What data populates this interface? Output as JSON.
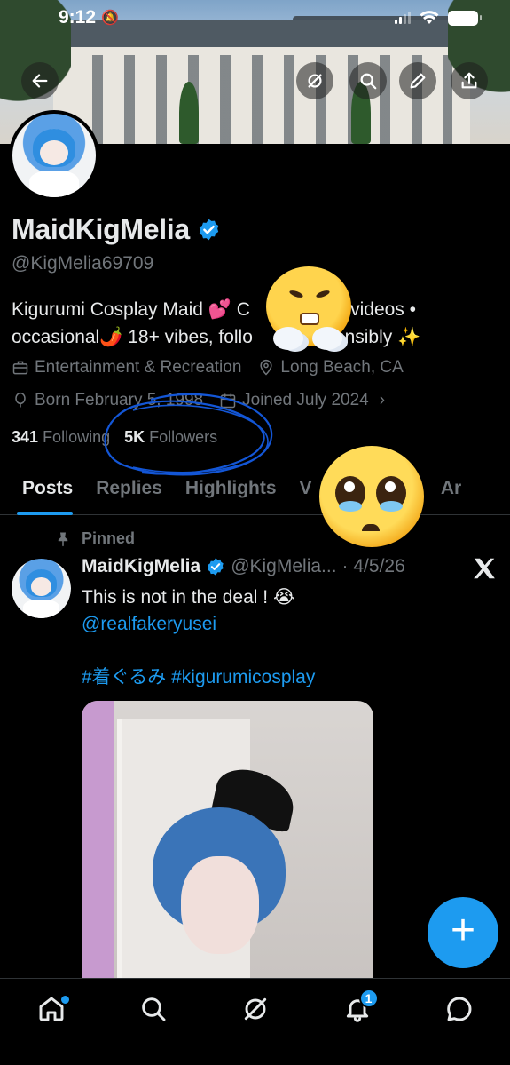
{
  "status_bar": {
    "time": "9:12"
  },
  "profile": {
    "name": "MaidKigMelia",
    "handle": "@KigMelia69709",
    "bio_line1": "Kigurumi Cosplay Maid 💕 C",
    "bio_line1_tail": "• videos •",
    "bio_line2": "occasional🌶️ 18+ vibes, follo",
    "bio_line2_tail": "onsibly ✨",
    "category": "Entertainment & Recreation",
    "location": "Long Beach, CA",
    "born": "Born February 5, 1998",
    "joined": "Joined July 2024",
    "following_count": "341",
    "following_label": "Following",
    "followers_count": "5K",
    "followers_label": "Followers"
  },
  "tabs": [
    "Posts",
    "Replies",
    "Highlights",
    "Videos",
    "Photos",
    "Articles"
  ],
  "tabs_visible": {
    "t0": "Posts",
    "t1": "Replies",
    "t2": "Highlights",
    "t3": "V",
    "t4": "otos",
    "t5": "Ar"
  },
  "post": {
    "pinned_label": "Pinned",
    "author_name": "MaidKigMelia",
    "author_handle": "@KigMelia...",
    "date": "· 4/5/26",
    "text": "This is not in the deal ! 😭",
    "mention": "@realfakeryusei",
    "hashtag1": "#着ぐるみ",
    "hashtag2": "#kigurumicosplay"
  },
  "notifications_badge": "1",
  "colors": {
    "accent": "#1d9bf0",
    "text_primary": "#e7e9ea",
    "text_secondary": "#71767b",
    "background": "#000000"
  },
  "icons": [
    "back-arrow-icon",
    "grok-icon",
    "search-icon",
    "pencil-icon",
    "share-icon",
    "verified-badge-icon",
    "briefcase-icon",
    "location-pin-icon",
    "balloon-icon",
    "calendar-icon",
    "pin-icon",
    "x-logo-icon",
    "plus-icon",
    "home-icon",
    "notifications-icon",
    "messages-icon"
  ]
}
